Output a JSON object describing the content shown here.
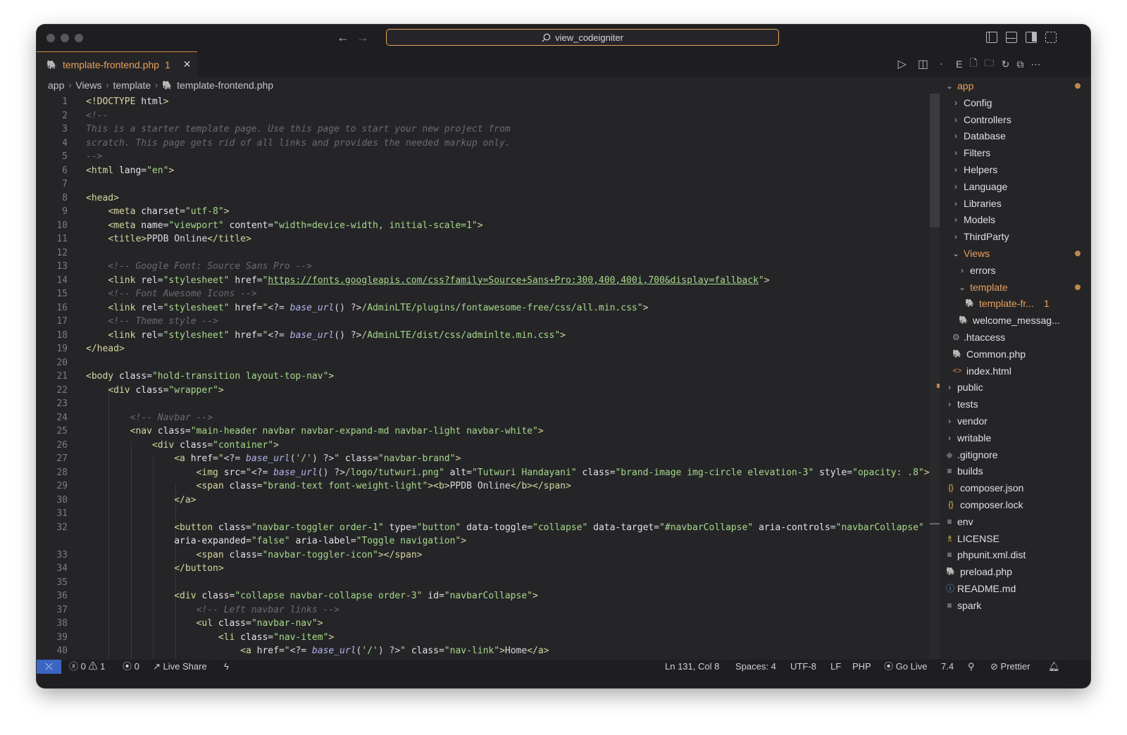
{
  "command_center": "view_codeigniter",
  "tab": {
    "title": "template-frontend.php",
    "problems": "1"
  },
  "breadcrumb": [
    "app",
    "Views",
    "template",
    "template-frontend.php"
  ],
  "code_lines": [
    {
      "n": "1",
      "html": "<span class='tg'>&lt;!DOCTYPE</span> <span class='at'>html</span><span class='tg'>&gt;</span>"
    },
    {
      "n": "2",
      "html": "<span class='cm'>&lt;!--</span>"
    },
    {
      "n": "3",
      "html": "<span class='cm'>This is a starter template page. Use this page to start your new project from</span>"
    },
    {
      "n": "4",
      "html": "<span class='cm'>scratch. This page gets rid of all links and provides the needed markup only.</span>"
    },
    {
      "n": "5",
      "html": "<span class='cm'>--&gt;</span>"
    },
    {
      "n": "6",
      "html": "<span class='tg'>&lt;html</span> <span class='at'>lang</span>=<span class='st'>\"en\"</span><span class='tg'>&gt;</span>"
    },
    {
      "n": "7",
      "html": ""
    },
    {
      "n": "8",
      "html": "<span class='tg'>&lt;head&gt;</span>"
    },
    {
      "n": "9",
      "html": "    <span class='tg'>&lt;meta</span> <span class='at'>charset</span>=<span class='st'>\"utf-8\"</span><span class='tg'>&gt;</span>"
    },
    {
      "n": "10",
      "html": "    <span class='tg'>&lt;meta</span> <span class='at'>name</span>=<span class='st'>\"viewport\"</span> <span class='at'>content</span>=<span class='st'>\"width=device-width, initial-scale=1\"</span><span class='tg'>&gt;</span>"
    },
    {
      "n": "11",
      "html": "    <span class='tg'>&lt;title&gt;</span>PPDB Online<span class='tg'>&lt;/title&gt;</span>"
    },
    {
      "n": "12",
      "html": ""
    },
    {
      "n": "13",
      "html": "    <span class='cm'>&lt;!-- Google Font: Source Sans Pro --&gt;</span>"
    },
    {
      "n": "14",
      "html": "    <span class='tg'>&lt;link</span> <span class='at'>rel</span>=<span class='st'>\"stylesheet\"</span> <span class='at'>href</span>=<span class='st'>\"</span><span class='lk'>https://fonts.googleapis.com/css?family=Source+Sans+Pro:300,400,400i,700&amp;display=fallback</span><span class='st'>\"</span><span class='tg'>&gt;</span>"
    },
    {
      "n": "15",
      "html": "    <span class='cm'>&lt;!-- Font Awesome Icons --&gt;</span>"
    },
    {
      "n": "16",
      "html": "    <span class='tg'>&lt;link</span> <span class='at'>rel</span>=<span class='st'>\"stylesheet\"</span> <span class='at'>href</span>=<span class='st'>\"</span>&lt;?= <span class='ph'>base_url</span>() ?&gt;<span class='st'>/AdminLTE/plugins/fontawesome-free/css/all.min.css\"</span><span class='tg'>&gt;</span>"
    },
    {
      "n": "17",
      "html": "    <span class='cm'>&lt;!-- Theme style --&gt;</span>"
    },
    {
      "n": "18",
      "html": "    <span class='tg'>&lt;link</span> <span class='at'>rel</span>=<span class='st'>\"stylesheet\"</span> <span class='at'>href</span>=<span class='st'>\"</span>&lt;?= <span class='ph'>base_url</span>() ?&gt;<span class='st'>/AdminLTE/dist/css/adminlte.min.css\"</span><span class='tg'>&gt;</span>"
    },
    {
      "n": "19",
      "html": "<span class='tg'>&lt;/head&gt;</span>"
    },
    {
      "n": "20",
      "html": ""
    },
    {
      "n": "21",
      "html": "<span class='tg'>&lt;body</span> <span class='at'>class</span>=<span class='st'>\"hold-transition layout-top-nav\"</span><span class='tg'>&gt;</span>"
    },
    {
      "n": "22",
      "html": "    <span class='tg'>&lt;div</span> <span class='at'>class</span>=<span class='st'>\"wrapper\"</span><span class='tg'>&gt;</span>"
    },
    {
      "n": "23",
      "html": ""
    },
    {
      "n": "24",
      "html": "        <span class='cm'>&lt;!-- Navbar --&gt;</span>"
    },
    {
      "n": "25",
      "html": "        <span class='tg'>&lt;nav</span> <span class='at'>class</span>=<span class='st'>\"main-header navbar navbar-expand-md navbar-light navbar-white\"</span><span class='tg'>&gt;</span>"
    },
    {
      "n": "26",
      "html": "            <span class='tg'>&lt;div</span> <span class='at'>class</span>=<span class='st'>\"container\"</span><span class='tg'>&gt;</span>"
    },
    {
      "n": "27",
      "html": "                <span class='tg'>&lt;a</span> <span class='at'>href</span>=<span class='st'>\"</span>&lt;?= <span class='ph'>base_url</span>(<span class='st'>'/'</span>) ?&gt;<span class='st'>\"</span> <span class='at'>class</span>=<span class='st'>\"navbar-brand\"</span><span class='tg'>&gt;</span>"
    },
    {
      "n": "28",
      "html": "                    <span class='tg'>&lt;img</span> <span class='at'>src</span>=<span class='st'>\"</span>&lt;?= <span class='ph'>base_url</span>() ?&gt;<span class='st'>/logo/tutwuri.png\"</span> <span class='at'>alt</span>=<span class='st'>\"Tutwuri Handayani\"</span> <span class='at'>class</span>=<span class='st'>\"brand-image img-circle elevation-3\"</span> <span class='at'>style</span>=<span class='st'>\"opacity: .8\"</span><span class='tg'>&gt;</span>"
    },
    {
      "n": "29",
      "html": "                    <span class='tg'>&lt;span</span> <span class='at'>class</span>=<span class='st'>\"brand-text font-weight-light\"</span><span class='tg'>&gt;&lt;b&gt;</span>PPDB Online<span class='tg'>&lt;/b&gt;&lt;/span&gt;</span>"
    },
    {
      "n": "30",
      "html": "                <span class='tg'>&lt;/a&gt;</span>"
    },
    {
      "n": "31",
      "html": ""
    },
    {
      "n": "32",
      "html": "                <span class='tg'>&lt;button</span> <span class='at'>class</span>=<span class='st'>\"navbar-toggler order-1\"</span> <span class='at'>type</span>=<span class='st'>\"button\"</span> <span class='at'>data-toggle</span>=<span class='st'>\"collapse\"</span> <span class='at'>data-target</span>=<span class='st'>\"#navbarCollapse\"</span> <span class='at'>aria-controls</span>=<span class='st'>\"navbarCollapse\"</span>"
    },
    {
      "n": "",
      "html": "                <span class='at'>aria-expanded</span>=<span class='st'>\"false\"</span> <span class='at'>aria-label</span>=<span class='st'>\"Toggle navigation\"</span><span class='tg'>&gt;</span>"
    },
    {
      "n": "33",
      "html": "                    <span class='tg'>&lt;span</span> <span class='at'>class</span>=<span class='st'>\"navbar-toggler-icon\"</span><span class='tg'>&gt;&lt;/span&gt;</span>"
    },
    {
      "n": "34",
      "html": "                <span class='tg'>&lt;/button&gt;</span>"
    },
    {
      "n": "35",
      "html": ""
    },
    {
      "n": "36",
      "html": "                <span class='tg'>&lt;div</span> <span class='at'>class</span>=<span class='st'>\"collapse navbar-collapse order-3\"</span> <span class='at'>id</span>=<span class='st'>\"navbarCollapse\"</span><span class='tg'>&gt;</span>"
    },
    {
      "n": "37",
      "html": "                    <span class='cm'>&lt;!-- Left navbar links --&gt;</span>"
    },
    {
      "n": "38",
      "html": "                    <span class='tg'>&lt;ul</span> <span class='at'>class</span>=<span class='st'>\"navbar-nav\"</span><span class='tg'>&gt;</span>"
    },
    {
      "n": "39",
      "html": "                        <span class='tg'>&lt;li</span> <span class='at'>class</span>=<span class='st'>\"nav-item\"</span><span class='tg'>&gt;</span>"
    },
    {
      "n": "40",
      "html": "                            <span class='tg'>&lt;a</span> <span class='at'>href</span>=<span class='st'>\"</span>&lt;?= <span class='ph'>base_url</span>(<span class='st'>'/'</span>) ?&gt;<span class='st'>\"</span> <span class='at'>class</span>=<span class='st'>\"nav-link\"</span><span class='tg'>&gt;</span>Home<span class='tg'>&lt;/a&gt;</span>"
    }
  ],
  "explorer": [
    {
      "label": "app",
      "depth": 0,
      "icon": "chevron-down",
      "mod": true
    },
    {
      "label": "Config",
      "depth": 1,
      "icon": "chevron-right"
    },
    {
      "label": "Controllers",
      "depth": 1,
      "icon": "chevron-right"
    },
    {
      "label": "Database",
      "depth": 1,
      "icon": "chevron-right"
    },
    {
      "label": "Filters",
      "depth": 1,
      "icon": "chevron-right"
    },
    {
      "label": "Helpers",
      "depth": 1,
      "icon": "chevron-right"
    },
    {
      "label": "Language",
      "depth": 1,
      "icon": "chevron-right"
    },
    {
      "label": "Libraries",
      "depth": 1,
      "icon": "chevron-right"
    },
    {
      "label": "Models",
      "depth": 1,
      "icon": "chevron-right"
    },
    {
      "label": "ThirdParty",
      "depth": 1,
      "icon": "chevron-right"
    },
    {
      "label": "Views",
      "depth": 1,
      "icon": "chevron-down",
      "mod": true
    },
    {
      "label": "errors",
      "depth": 2,
      "icon": "chevron-right"
    },
    {
      "label": "template",
      "depth": 2,
      "icon": "chevron-down",
      "mod": true
    },
    {
      "label": "template-fr...",
      "depth": 3,
      "icon": "php",
      "mod": true,
      "badge": "1"
    },
    {
      "label": "welcome_messag...",
      "depth": 2,
      "icon": "php"
    },
    {
      "label": ".htaccess",
      "depth": 1,
      "icon": "gear"
    },
    {
      "label": "Common.php",
      "depth": 1,
      "icon": "php"
    },
    {
      "label": "index.html",
      "depth": 1,
      "icon": "html"
    },
    {
      "label": "public",
      "depth": 0,
      "icon": "chevron-right"
    },
    {
      "label": "tests",
      "depth": 0,
      "icon": "chevron-right"
    },
    {
      "label": "vendor",
      "depth": 0,
      "icon": "chevron-right"
    },
    {
      "label": "writable",
      "depth": 0,
      "icon": "chevron-right"
    },
    {
      "label": ".gitignore",
      "depth": 0,
      "icon": "git"
    },
    {
      "label": "builds",
      "depth": 0,
      "icon": "lines"
    },
    {
      "label": "composer.json",
      "depth": 0,
      "icon": "braces"
    },
    {
      "label": "composer.lock",
      "depth": 0,
      "icon": "braces"
    },
    {
      "label": "env",
      "depth": 0,
      "icon": "lines"
    },
    {
      "label": "LICENSE",
      "depth": 0,
      "icon": "license"
    },
    {
      "label": "phpunit.xml.dist",
      "depth": 0,
      "icon": "lines"
    },
    {
      "label": "preload.php",
      "depth": 0,
      "icon": "php"
    },
    {
      "label": "README.md",
      "depth": 0,
      "icon": "info"
    },
    {
      "label": "spark",
      "depth": 0,
      "icon": "lines"
    }
  ],
  "sidebar_head_letter": "E",
  "status": {
    "errors": "0",
    "warnings": "1",
    "ports": "0",
    "live_share": "Live Share",
    "position": "Ln 131, Col 8",
    "spaces": "Spaces: 4",
    "encoding": "UTF-8",
    "eol": "LF",
    "language": "PHP",
    "go_live": "Go Live",
    "version": "7.4",
    "prettier": "Prettier"
  },
  "colors": {
    "accent": "#e8a05a",
    "remote": "#3b66c4"
  }
}
